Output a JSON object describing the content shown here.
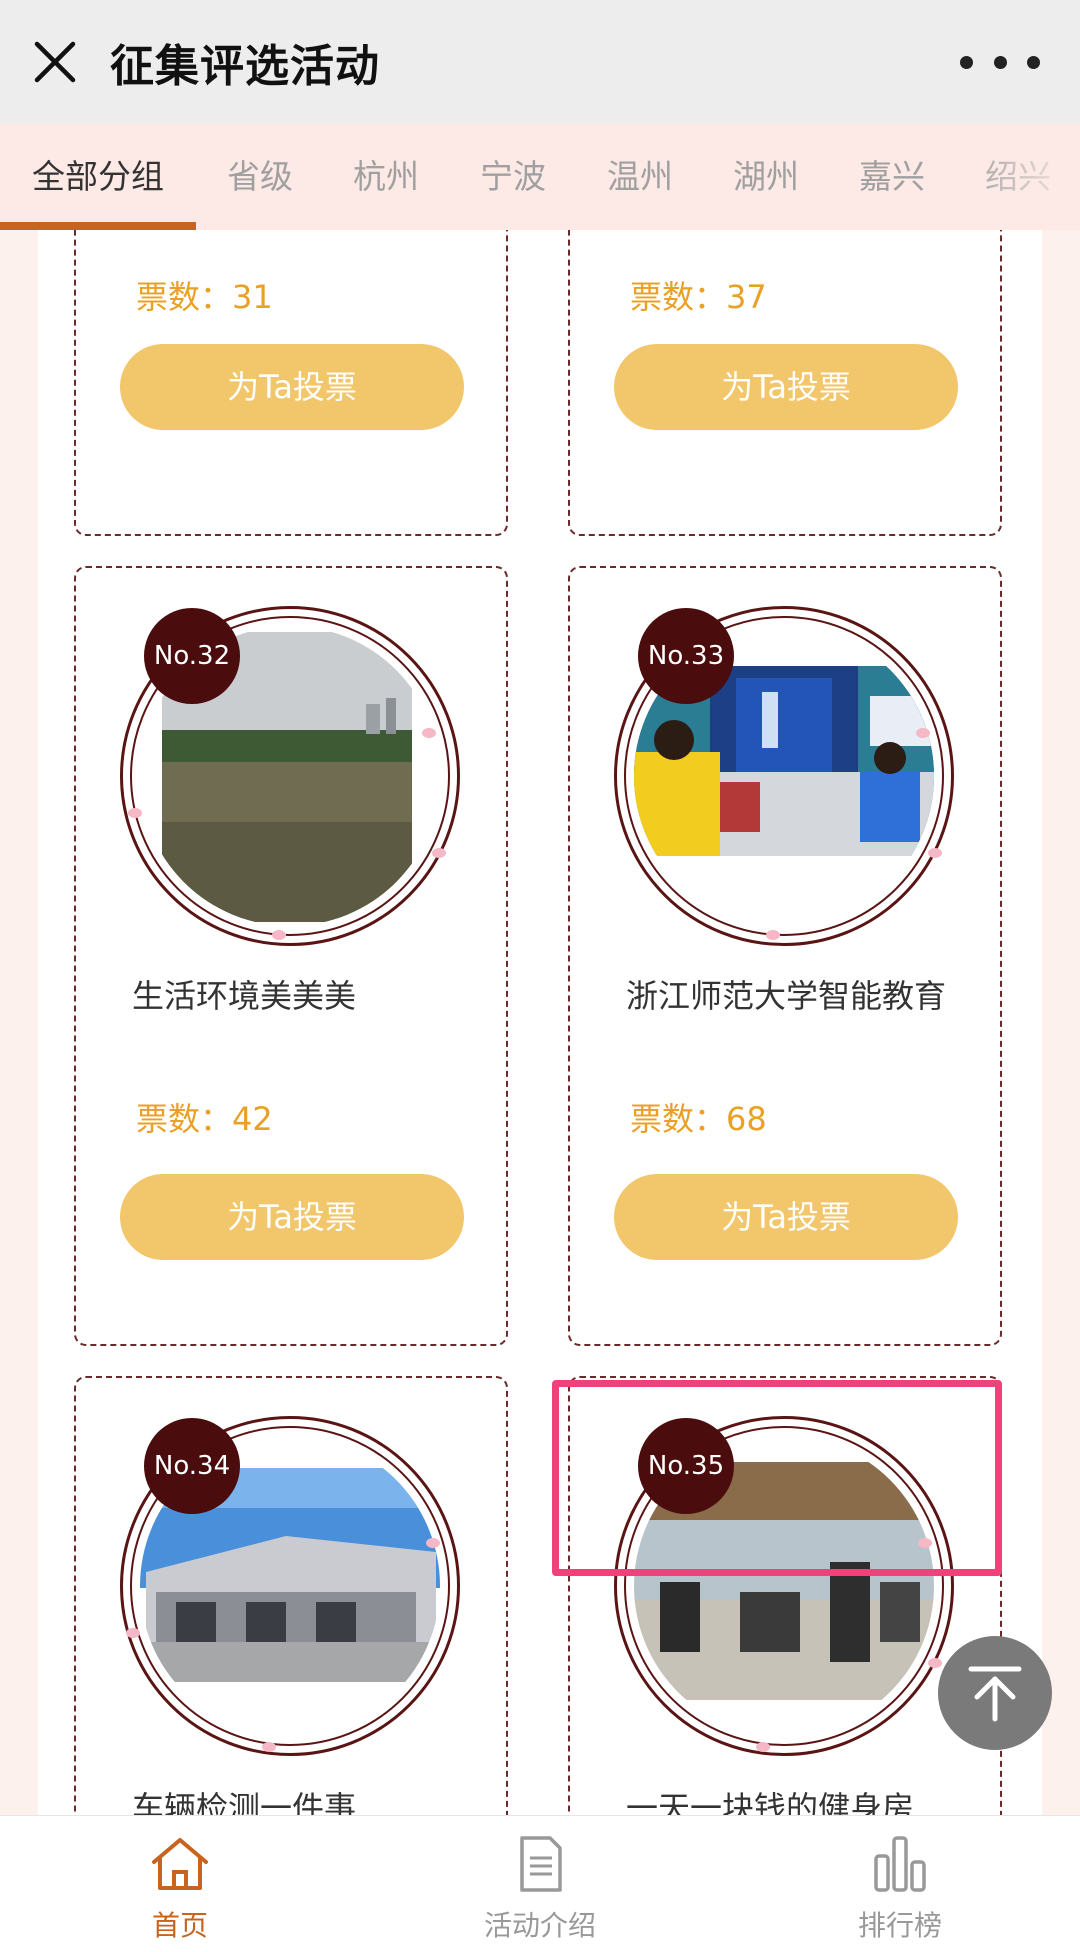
{
  "header": {
    "title": "征集评选活动",
    "close_icon": "close-icon",
    "more_icon": "more-icon"
  },
  "tabs": [
    {
      "label": "全部分组",
      "active": true
    },
    {
      "label": "省级"
    },
    {
      "label": "杭州"
    },
    {
      "label": "宁波"
    },
    {
      "label": "温州"
    },
    {
      "label": "湖州"
    },
    {
      "label": "嘉兴"
    },
    {
      "label": "绍兴"
    }
  ],
  "cards": [
    {
      "votes": "票数：31",
      "button": "为Ta投票"
    },
    {
      "votes": "票数：37",
      "button": "为Ta投票"
    },
    {
      "number": "No.32",
      "name": "生活环境美美美",
      "votes": "票数：42",
      "button": "为Ta投票"
    },
    {
      "number": "No.33",
      "name": "浙江师范大学智能教育",
      "votes": "票数：68",
      "button": "为Ta投票"
    },
    {
      "number": "No.34",
      "name": "车辆检测一件事"
    },
    {
      "number": "No.35",
      "name": "一天一块钱的健身房"
    }
  ],
  "bottom_nav": [
    {
      "label": "首页",
      "icon": "home-icon",
      "active": true
    },
    {
      "label": "活动介绍",
      "icon": "document-icon"
    },
    {
      "label": "排行榜",
      "icon": "bar-chart-icon"
    }
  ],
  "colors": {
    "accent": "#c8641e",
    "vote_button": "#f2c66b",
    "vote_text": "#e9a025",
    "badge": "#4a0c0c",
    "highlight": "#f0417a"
  }
}
